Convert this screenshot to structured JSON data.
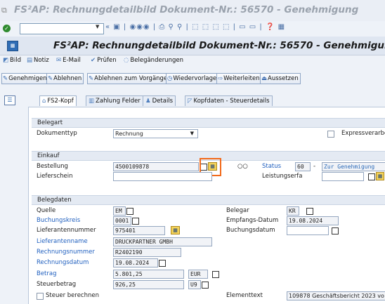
{
  "window": {
    "title": "FS²AP: Rechnungdetailbild Dokument-Nr.: 56570 - Genehmigung"
  },
  "screen": {
    "title": "FS²AP: Rechnungdetailbild Dokument-Nr.: 56570 - Genehmigung"
  },
  "app_toolbar": [
    {
      "label": "Bild",
      "icon": "image-icon"
    },
    {
      "label": "Notiz",
      "icon": "note-icon"
    },
    {
      "label": "E-Mail",
      "icon": "email-icon"
    },
    {
      "label": "Prüfen",
      "icon": "check-icon"
    },
    {
      "label": "Belegänderungen",
      "icon": "glasses-icon"
    }
  ],
  "action_buttons": [
    {
      "label": "Genehmigen",
      "icon": "approve-icon"
    },
    {
      "label": "Ablehnen",
      "icon": "reject-icon"
    },
    {
      "label": "Ablehnen zum Vorgänger",
      "icon": "reject-prev-icon"
    },
    {
      "label": "Wiedervorlage",
      "icon": "resubmit-icon"
    },
    {
      "label": "Weiterleiten",
      "icon": "forward-icon"
    },
    {
      "label": "Aussetzen",
      "icon": "suspend-icon"
    }
  ],
  "tabs": [
    {
      "label": "FS2-Kopf",
      "active": true
    },
    {
      "label": "Zahlung Felder"
    },
    {
      "label": "Details"
    },
    {
      "label": "Kopfdaten - Steuerdetails"
    }
  ],
  "belegart": {
    "section": "Belegart",
    "doc_type_label": "Dokumenttyp",
    "doc_type_value": "Rechnung",
    "express_label": "Expressverarbe"
  },
  "einkauf": {
    "section": "Einkauf",
    "bestellung_label": "Bestellung",
    "bestellung_value": "4500109878",
    "lieferschein_label": "Lieferschein",
    "status_label": "Status",
    "status_code": "60",
    "status_sep": "-",
    "status_text": "Zur Genehmigung",
    "leistungserfa_label": "Leistungserfa"
  },
  "belegdaten": {
    "section": "Belegdaten",
    "quelle_label": "Quelle",
    "quelle_value": "EM",
    "buchungskreis_label": "Buchungskreis",
    "buchungskreis_value": "0001",
    "lieferantennummer_label": "Lieferantennummer",
    "lieferantennummer_value": "975401",
    "lieferantenname_label": "Lieferantenname",
    "lieferantenname_value": "DRUCKPARTNER GMBH",
    "rechnungsnummer_label": "Rechnungsnummer",
    "rechnungsnummer_value": "R2402190",
    "rechnungsdatum_label": "Rechnungsdatum",
    "rechnungsdatum_value": "19.08.2024",
    "betrag_label": "Betrag",
    "betrag_value": "5.801,25",
    "currency": "EUR",
    "steuerbetrag_label": "Steuerbetrag",
    "steuerbetrag_value": "926,25",
    "tax_code": "U9",
    "steuer_berechnen_label": "Steuer berechnen",
    "belegar_label": "Belegar",
    "belegar_value": "KR",
    "empfangs_label": "Empfangs-Datum",
    "empfangs_value": "19.08.2024",
    "buchungsdatum_label": "Buchungsdatum",
    "buchungsdatum_value": "",
    "elementtext_label": "Elementtext",
    "elementtext_value": "109878 Geschäftsbericht 2023 vo"
  }
}
